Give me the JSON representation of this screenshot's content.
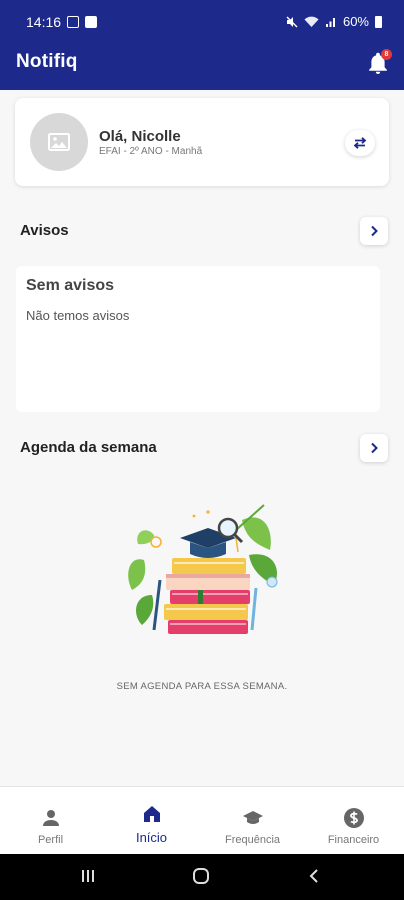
{
  "status_bar": {
    "time": "14:16",
    "battery": "60%"
  },
  "app_bar": {
    "title": "Notifiq",
    "notification_count": "8",
    "colors": {
      "primary": "#1d2a8c",
      "badge": "#e53935"
    }
  },
  "profile": {
    "greeting": "Olá, Nicolle",
    "class_info": "EFAI - 2º ANO - Manhã",
    "icons": {
      "avatar": "image-placeholder-icon",
      "switch": "swap-arrows-icon"
    }
  },
  "avisos": {
    "section_title": "Avisos",
    "card_title": "Sem avisos",
    "card_text": "Não temos avisos"
  },
  "agenda": {
    "section_title": "Agenda da semana",
    "empty_text": "SEM AGENDA PARA ESSA SEMANA."
  },
  "bottom_nav": {
    "items": [
      {
        "label": "Perfil",
        "icon": "person-icon",
        "active": false
      },
      {
        "label": "Início",
        "icon": "home-icon",
        "active": true
      },
      {
        "label": "Frequência",
        "icon": "graduation-cap-icon",
        "active": false
      },
      {
        "label": "Financeiro",
        "icon": "dollar-icon",
        "active": false
      }
    ]
  }
}
